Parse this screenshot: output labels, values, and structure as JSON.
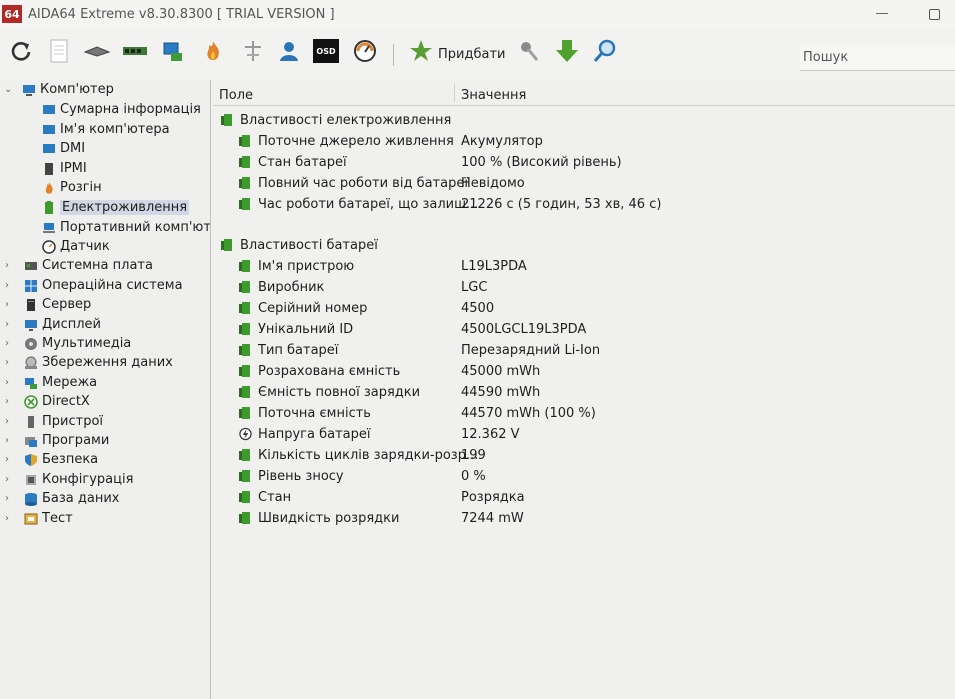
{
  "window": {
    "app_badge": "64",
    "title": "AIDA64 Extreme v8.30.8300  [ TRIAL VERSION ]"
  },
  "toolbar": {
    "buy_label": "Придбати",
    "search_placeholder": "Пошук",
    "osd_label": "OSD"
  },
  "tree": {
    "root": "Комп'ютер",
    "children": [
      {
        "label": "Сумарна інформація",
        "icon": "computer-summary-icon"
      },
      {
        "label": "Ім'я комп'ютера",
        "icon": "computer-name-icon"
      },
      {
        "label": "DMI",
        "icon": "dmi-icon"
      },
      {
        "label": "IPMI",
        "icon": "ipmi-icon"
      },
      {
        "label": "Розгін",
        "icon": "flame-icon"
      },
      {
        "label": "Електроживлення",
        "icon": "power-icon",
        "selected": true
      },
      {
        "label": "Портативний комп'юте",
        "icon": "laptop-icon"
      },
      {
        "label": "Датчик",
        "icon": "gauge-icon"
      }
    ],
    "groups": [
      {
        "label": "Системна плата",
        "icon": "motherboard-icon"
      },
      {
        "label": "Операційна система",
        "icon": "windows-icon"
      },
      {
        "label": "Сервер",
        "icon": "server-icon"
      },
      {
        "label": "Дисплей",
        "icon": "monitor-icon"
      },
      {
        "label": "Мультимедіа",
        "icon": "multimedia-icon"
      },
      {
        "label": "Збереження даних",
        "icon": "storage-icon"
      },
      {
        "label": "Мережа",
        "icon": "network-icon"
      },
      {
        "label": "DirectX",
        "icon": "directx-icon"
      },
      {
        "label": "Пристрої",
        "icon": "devices-icon"
      },
      {
        "label": "Програми",
        "icon": "programs-icon"
      },
      {
        "label": "Безпека",
        "icon": "security-shield-icon"
      },
      {
        "label": "Конфігурація",
        "icon": "configuration-icon"
      },
      {
        "label": "База даних",
        "icon": "database-icon"
      },
      {
        "label": "Тест",
        "icon": "benchmark-icon"
      }
    ]
  },
  "table": {
    "col_field": "Поле",
    "col_value": "Значення",
    "sections": [
      {
        "title": "Властивості електроживлення",
        "rows": [
          {
            "field": "Поточне джерело живлення",
            "value": "Акумулятор"
          },
          {
            "field": "Стан батареї",
            "value": "100 % (Високий рівень)"
          },
          {
            "field": "Повний час роботи від батареї",
            "value": "Невідомо"
          },
          {
            "field": "Час роботи батареї, що залиш...",
            "value": "21226 с (5 годин, 53 хв, 46 с)"
          }
        ]
      },
      {
        "title": "Властивості батареї",
        "rows": [
          {
            "field": "Ім'я пристрою",
            "value": "L19L3PDA"
          },
          {
            "field": "Виробник",
            "value": "LGC"
          },
          {
            "field": "Серійний номер",
            "value": "4500"
          },
          {
            "field": "Унікальний ID",
            "value": "4500LGCL19L3PDA"
          },
          {
            "field": "Тип батареї",
            "value": "Перезарядний Li-Ion"
          },
          {
            "field": "Розрахована ємність",
            "value": "45000 mWh"
          },
          {
            "field": "Ємність повної зарядки",
            "value": "44590 mWh"
          },
          {
            "field": "Поточна ємність",
            "value": "44570 mWh  (100 %)"
          },
          {
            "field": "Напруга батареї",
            "value": "12.362 V",
            "icon": "voltage-icon"
          },
          {
            "field": "Кількість циклів зарядки-розр...",
            "value": "199"
          },
          {
            "field": "Рівень зносу",
            "value": "0 %"
          },
          {
            "field": "Стан",
            "value": "Розрядка"
          },
          {
            "field": "Швидкість розрядки",
            "value": "7244 mW"
          }
        ]
      }
    ]
  },
  "colors": {
    "battery_green": "#3d9a2c",
    "selection": "#cfd8e4",
    "brand_red": "#b22a26"
  }
}
